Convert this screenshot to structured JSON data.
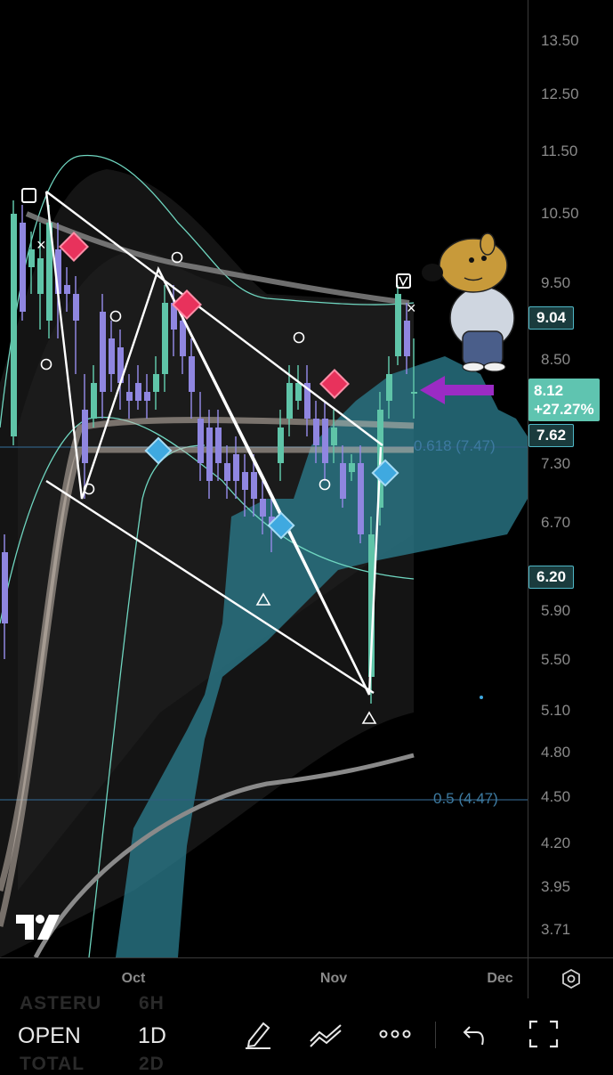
{
  "chart": {
    "price_ticks": [
      "13.50",
      "12.50",
      "11.50",
      "10.50",
      "9.50",
      "8.50",
      "7.30",
      "6.70",
      "5.90",
      "5.50",
      "5.10",
      "4.80",
      "4.50",
      "4.20",
      "3.95",
      "3.71"
    ],
    "time_labels": [
      "Oct",
      "Nov",
      "Dec"
    ],
    "fib_upper": "0.618 (7.47)",
    "fib_lower": "0.5 (4.47)",
    "badges": {
      "high": "9.04",
      "current_price": "8.12",
      "current_change": "+27.27%",
      "level_a": "7.62",
      "level_b": "6.20"
    },
    "colors": {
      "bull": "#5fc4a8",
      "bear": "#8f86e0",
      "cloud": "#2c7f90",
      "pink_marker": "#e8325c",
      "blue_marker": "#3fa9e0",
      "arrow": "#9b2bc4"
    }
  },
  "toolbar": {
    "open_label": "OPEN",
    "interval_label": "1D",
    "ghost_symbol_1": "ASTERU",
    "ghost_interval_1": "6H",
    "ghost_symbol_2": "TOTAL",
    "ghost_interval_2": "2D"
  }
}
